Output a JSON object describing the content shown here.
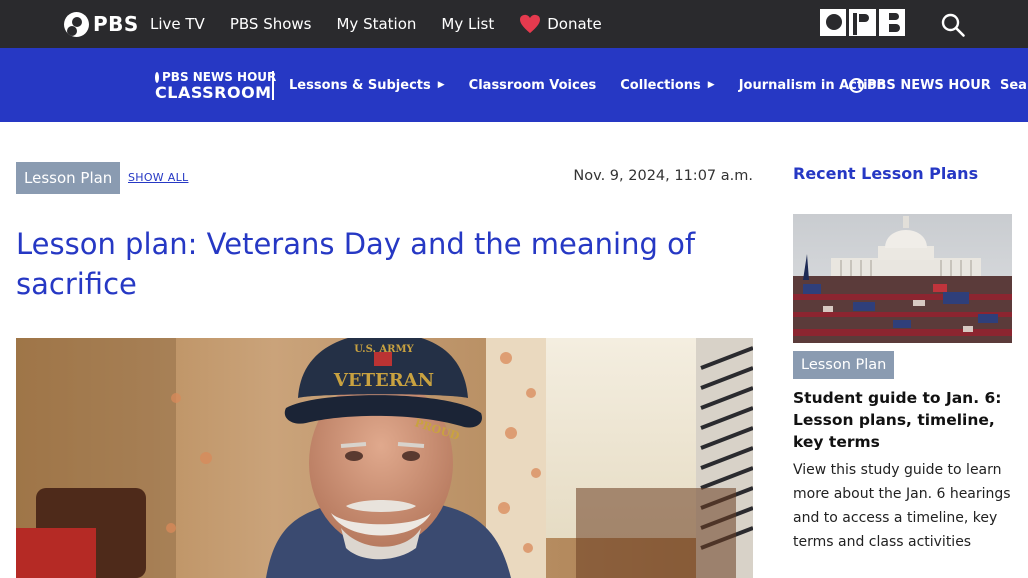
{
  "topbar": {
    "logo_text": "PBS",
    "nav": [
      "Live TV",
      "PBS Shows",
      "My Station",
      "My List"
    ],
    "donate_label": "Donate",
    "station_logo": "OPB",
    "icons": {
      "search": "search-icon",
      "donate": "heart-icon"
    },
    "colors": {
      "background": "#2a2a2d",
      "heart": "#e53a4e"
    }
  },
  "classroom_bar": {
    "logo_line1": "PBS NEWS HOUR",
    "logo_line2": "CLASSROOM",
    "nav": [
      {
        "label": "Lessons & Subjects",
        "has_caret": true
      },
      {
        "label": "Classroom Voices",
        "has_caret": false
      },
      {
        "label": "Collections",
        "has_caret": true
      },
      {
        "label": "Journalism in Action",
        "has_caret": false
      }
    ],
    "caret_glyph": "▶",
    "partner_logo": "PBS NEWS HOUR",
    "search_label": "Sear",
    "colors": {
      "background": "#2638c4"
    }
  },
  "article": {
    "tag": "Lesson Plan",
    "show_all": "SHOW ALL",
    "date": "Nov. 9, 2024, 11:07 a.m.",
    "headline": "Lesson plan: Veterans Day and the meaning of sacrifice",
    "hero_cap_text": [
      "U.S. ARMY",
      "VETERAN",
      "PROUD"
    ]
  },
  "sidebar": {
    "heading": "Recent Lesson Plans",
    "card": {
      "tag": "Lesson Plan",
      "title": "Student guide to Jan. 6: Lesson plans, timeline, key terms",
      "description": "View this study guide to learn more about the Jan. 6 hearings and to access a timeline, key terms and class activities"
    }
  },
  "colors": {
    "accent": "#2638c4",
    "tag_bg": "#8a9bb1"
  }
}
